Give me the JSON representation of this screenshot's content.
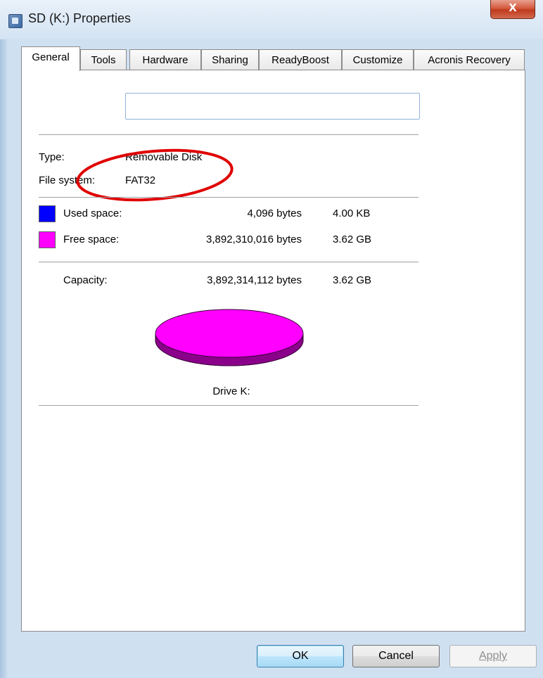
{
  "window": {
    "title": "SD (K:) Properties",
    "close_label": "X",
    "accent_color": "#d2fbf8"
  },
  "tabs": [
    {
      "label": "General",
      "active": true
    },
    {
      "label": "Tools"
    },
    {
      "label": "Hardware"
    },
    {
      "label": "Sharing"
    },
    {
      "label": "ReadyBoost"
    },
    {
      "label": "Customize"
    },
    {
      "label": "Acronis Recovery"
    }
  ],
  "general": {
    "volume_name": "",
    "type_label": "Type:",
    "type_value": "Removable Disk",
    "fs_label": "File system:",
    "fs_value": "FAT32",
    "used": {
      "label": "Used space:",
      "bytes": "4,096 bytes",
      "size": "4.00 KB",
      "color": "#0000ff"
    },
    "free": {
      "label": "Free space:",
      "bytes": "3,892,310,016 bytes",
      "size": "3.62 GB",
      "color": "#ff00ff"
    },
    "capacity": {
      "label": "Capacity:",
      "bytes": "3,892,314,112 bytes",
      "size": "3.62 GB"
    },
    "drive_label": "Drive K:",
    "annotation_color": "#e00000"
  },
  "buttons": {
    "ok": "OK",
    "cancel": "Cancel",
    "apply": "Apply"
  }
}
